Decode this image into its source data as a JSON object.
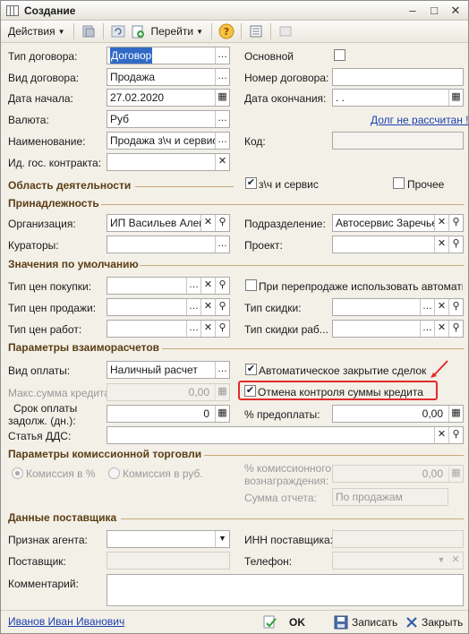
{
  "window": {
    "title": "Создание"
  },
  "toolbar": {
    "actions": "Действия",
    "goto": "Перейти"
  },
  "fields": {
    "contract_type": {
      "label": "Тип договора:",
      "value": "Договор"
    },
    "contract_kind": {
      "label": "Вид договора:",
      "value": "Продажа"
    },
    "start_date": {
      "label": "Дата начала:",
      "value": "27.02.2020"
    },
    "currency": {
      "label": "Валюта:",
      "value": "Руб"
    },
    "name": {
      "label": "Наименование:",
      "value": "Продажа з\\ч и сервис"
    },
    "gov_contract": {
      "label": "Ид. гос. контракта:",
      "value": ""
    },
    "main": {
      "label": "Основной"
    },
    "contract_number": {
      "label": "Номер договора:",
      "value": ""
    },
    "end_date": {
      "label": "Дата окончания:",
      "value": " .  ."
    },
    "debt_link": "Долг не рассчитан !",
    "code": {
      "label": "Код:",
      "value": ""
    }
  },
  "activity": {
    "title": "Область деятельности",
    "parts_service": "з\\ч и сервис",
    "other": "Прочее"
  },
  "belonging": {
    "title": "Принадлежность",
    "organization": {
      "label": "Организация:",
      "value": "ИП Васильев Алекс"
    },
    "department": {
      "label": "Подразделение:",
      "value": "Автосервис Заречье"
    },
    "curators": {
      "label": "Кураторы:",
      "value": ""
    },
    "project": {
      "label": "Проект:",
      "value": ""
    }
  },
  "defaults": {
    "title": "Значения по умолчанию",
    "purchase_price": {
      "label": "Тип цен покупки:",
      "value": ""
    },
    "resale_auto": "При перепродаже использовать автоматич",
    "sale_price": {
      "label": "Тип цен продажи:",
      "value": ""
    },
    "discount": {
      "label": "Тип скидки:",
      "value": ""
    },
    "work_price": {
      "label": "Тип цен работ:",
      "value": ""
    },
    "work_discount": {
      "label": "Тип скидки раб...",
      "value": ""
    }
  },
  "settlements": {
    "title": "Параметры взаиморасчетов",
    "payment_kind": {
      "label": "Вид оплаты:",
      "value": "Наличный расчет"
    },
    "auto_close": "Автоматическое закрытие сделок",
    "max_credit": {
      "label": "Макс.сумма кредита:",
      "value": "0,00"
    },
    "cancel_credit_control": "Отмена контроля суммы кредита",
    "pay_delay": {
      "label_1": "Срок оплаты",
      "label_2": "задолж. (дн.):",
      "value": "0"
    },
    "prepay": {
      "label": "% предоплаты:",
      "value": "0,00"
    },
    "dds": {
      "label": "Статья ДДС:",
      "value": ""
    }
  },
  "commission": {
    "title": "Параметры комиссионной торговли",
    "percent": "Комиссия в %",
    "rub": "Комиссия в руб.",
    "fee_label_1": "% комиссионного",
    "fee_label_2": "вознаграждения:",
    "fee_value": "0,00",
    "report_sum": {
      "label": "Сумма отчета:",
      "value": "По продажам"
    }
  },
  "supplier": {
    "title": "Данные поставщика",
    "agent": {
      "label": "Признак агента:",
      "value": ""
    },
    "inn": {
      "label": "ИНН поставщика:",
      "value": ""
    },
    "supplier": {
      "label": "Поставщик:",
      "value": ""
    },
    "phone": {
      "label": "Телефон:",
      "value": ""
    }
  },
  "comment": {
    "label": "Комментарий:",
    "value": ""
  },
  "footer": {
    "user": "Иванов Иван Иванович",
    "ok": "OK",
    "save": "Записать",
    "close": "Закрыть"
  },
  "colors": {
    "section": "#5c3d14",
    "link": "#1a3fb0",
    "selection": "#316ac5",
    "highlight": "#e32b2b"
  },
  "checks": {
    "main": false,
    "parts_service": true,
    "other": false,
    "resale_auto": false,
    "auto_close": true,
    "cancel_credit_control": true,
    "commission_percent": true
  }
}
